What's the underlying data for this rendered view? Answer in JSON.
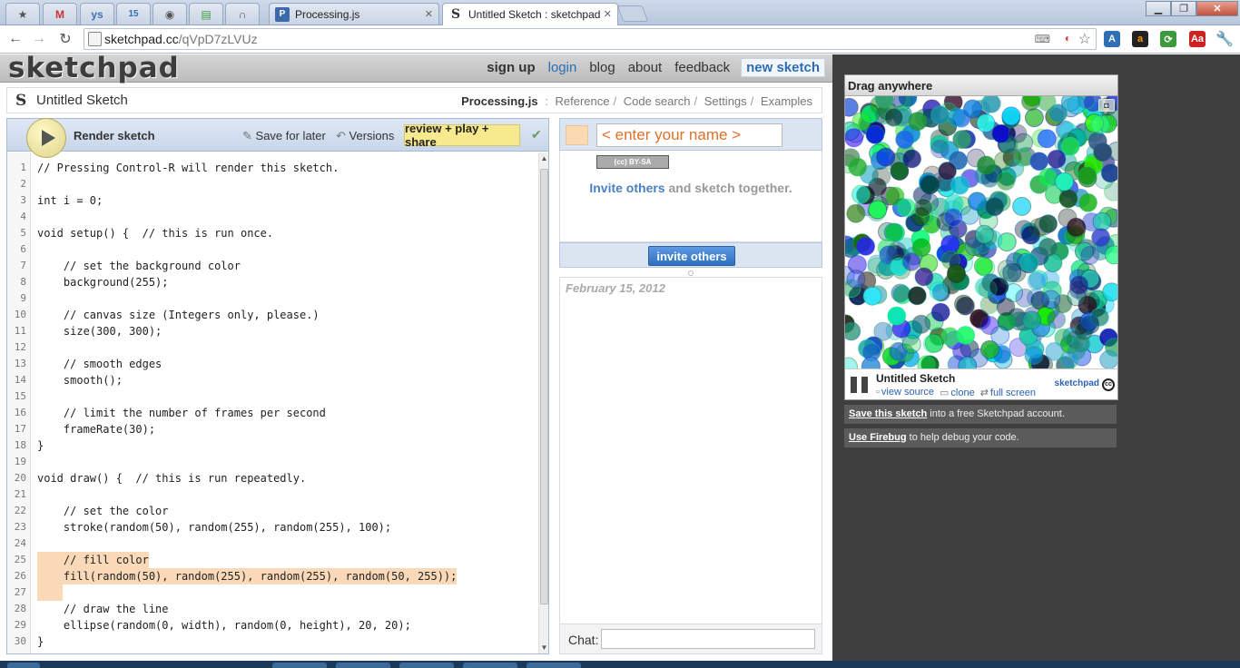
{
  "browser": {
    "pinned_tabs": [
      {
        "icon": "star-icon",
        "glyph": "★",
        "color": "#777777"
      },
      {
        "icon": "gmail-icon",
        "glyph": "M",
        "color": "#cc3333"
      },
      {
        "icon": "yahoo-sports-icon",
        "glyph": "ys",
        "color": "#3f71b6"
      },
      {
        "icon": "calendar-icon",
        "glyph": "15",
        "color": "#2f6fb3"
      },
      {
        "icon": "globe-icon",
        "glyph": "◉",
        "color": "#555555"
      },
      {
        "icon": "chart-icon",
        "glyph": "▤",
        "color": "#3d9b3d"
      },
      {
        "icon": "headphones-icon",
        "glyph": "∩",
        "color": "#555555"
      }
    ],
    "tabs": [
      {
        "title": "Processing.js",
        "active": false
      },
      {
        "title": "Untitled Sketch : sketchpad",
        "active": true
      }
    ],
    "url_host": "sketchpad.cc",
    "url_path": "/qVpD7zLVUz"
  },
  "site": {
    "logo": "sketchpad",
    "nav": {
      "signup": "sign up",
      "login": "login",
      "blog": "blog",
      "about": "about",
      "feedback": "feedback",
      "new_sketch": "new sketch"
    },
    "sketch_title": "Untitled Sketch",
    "links": {
      "processing": "Processing.js",
      "separator_colon": ":",
      "reference": "Reference",
      "code_search": "Code search",
      "settings": "Settings",
      "examples": "Examples"
    }
  },
  "editor": {
    "render_label": "Render sketch",
    "save_label": "Save for later",
    "versions_label": "Versions",
    "review_label": "review + play + share",
    "lines": [
      "// Pressing Control-R will render this sketch.",
      "",
      "int i = 0;",
      "",
      "void setup() {  // this is run once.",
      "",
      "    // set the background color",
      "    background(255);",
      "",
      "    // canvas size (Integers only, please.)",
      "    size(300, 300);",
      "",
      "    // smooth edges",
      "    smooth();",
      "",
      "    // limit the number of frames per second",
      "    frameRate(30);",
      "}",
      "",
      "void draw() {  // this is run repeatedly.",
      "",
      "    // set the color",
      "    stroke(random(50), random(255), random(255), 100);",
      "",
      "    // fill color",
      "    fill(random(50), random(255), random(255), random(50, 255));",
      "",
      "    // draw the line",
      "    ellipse(random(0, width), random(0, height), 20, 20);",
      "}"
    ],
    "line_numbers": [
      "1",
      "2",
      "3",
      "4",
      "5",
      "6",
      "7",
      "8",
      "9",
      "10",
      "11",
      "12",
      "13",
      "14",
      "15",
      "16",
      "17",
      "18",
      "19",
      "20",
      "21",
      "22",
      "23",
      "24",
      "25",
      "26",
      "27",
      "28",
      "29",
      "30"
    ],
    "highlight_color": "#f9d9b8"
  },
  "collab": {
    "name_placeholder": "< enter your name >",
    "license": "BY-SA",
    "invite_highlight": "Invite others",
    "invite_rest": " and sketch together.",
    "invite_button": "invite others",
    "chat_date": "February 15, 2012",
    "chat_label": "Chat:",
    "user_color": "#fbd9b1"
  },
  "preview": {
    "header": "Drag anywhere",
    "title": "Untitled Sketch",
    "view_source": "view source",
    "clone": "clone",
    "full_screen": "full screen",
    "brand": "sketchpad",
    "cc": "cc"
  },
  "tips": [
    {
      "link": "Save this sketch",
      "text": " into a free Sketchpad account."
    },
    {
      "link": "Use Firebug",
      "text": " to help debug your code."
    }
  ]
}
